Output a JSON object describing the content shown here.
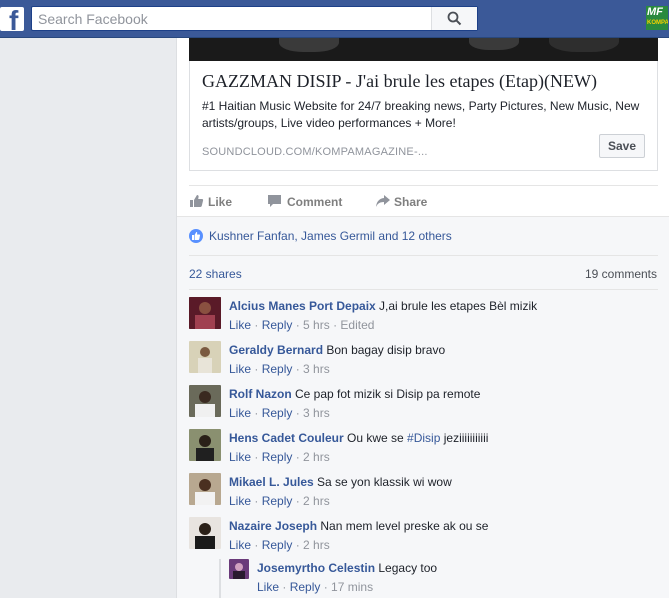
{
  "topbar": {
    "logo": "f",
    "search_placeholder": "Search Facebook",
    "app_icon_line1": "MF",
    "app_icon_line2": "KOMPA"
  },
  "link": {
    "title": "GAZZMAN DISIP - J'ai brule les etapes (Etap)(NEW)",
    "description": "#1 Haitian Music Website for 24/7 breaking news, Party Pictures, New Music, New artists/groups, Live video performances + More!",
    "domain": "SOUNDCLOUD.COM/KOMPAMAGAZINE-...",
    "save_label": "Save"
  },
  "actions": {
    "like": "Like",
    "comment": "Comment",
    "share": "Share"
  },
  "reactions": {
    "text": "Kushner Fanfan, James Germil and 12 others"
  },
  "stats": {
    "shares": "22 shares",
    "comments": "19 comments"
  },
  "comments": [
    {
      "author": "Alcius Manes Port Depaix",
      "text": " J,ai brule les etapes Bèl mizik",
      "like": "Like",
      "reply": "Reply",
      "time": "5 hrs",
      "extra": " · Edited",
      "avatar_color": "#7a2a3a"
    },
    {
      "author": "Geraldy Bernard",
      "text": " Bon bagay disip bravo",
      "like": "Like",
      "reply": "Reply",
      "time": "3 hrs",
      "extra": "",
      "avatar_color": "#c8c2a8"
    },
    {
      "author": "Rolf Nazon",
      "text": " Ce pap fot mizik si Disip pa remote",
      "like": "Like",
      "reply": "Reply",
      "time": "3 hrs",
      "extra": "",
      "avatar_color": "#4a4a40"
    },
    {
      "author": "Hens Cadet Couleur",
      "text": " Ou kwe se ",
      "hashtag": "#Disip",
      "text2": " jeziiiiiiiiiii",
      "like": "Like",
      "reply": "Reply",
      "time": "2 hrs",
      "extra": "",
      "avatar_color": "#55604a"
    },
    {
      "author": "Mikael L. Jules",
      "text": " Sa se yon klassik wi wow",
      "like": "Like",
      "reply": "Reply",
      "time": "2 hrs",
      "extra": "",
      "avatar_color": "#6a5a48"
    },
    {
      "author": "Nazaire Joseph",
      "text": " Nan mem level preske ak ou se",
      "like": "Like",
      "reply": "Reply",
      "time": "2 hrs",
      "extra": "",
      "avatar_color": "#3a3530"
    }
  ],
  "reply": {
    "author": "Josemyrtho Celestin",
    "text": " Legacy too",
    "like": "Like",
    "reply": "Reply",
    "time": "17 mins",
    "avatar_color": "#6a3a7a"
  }
}
